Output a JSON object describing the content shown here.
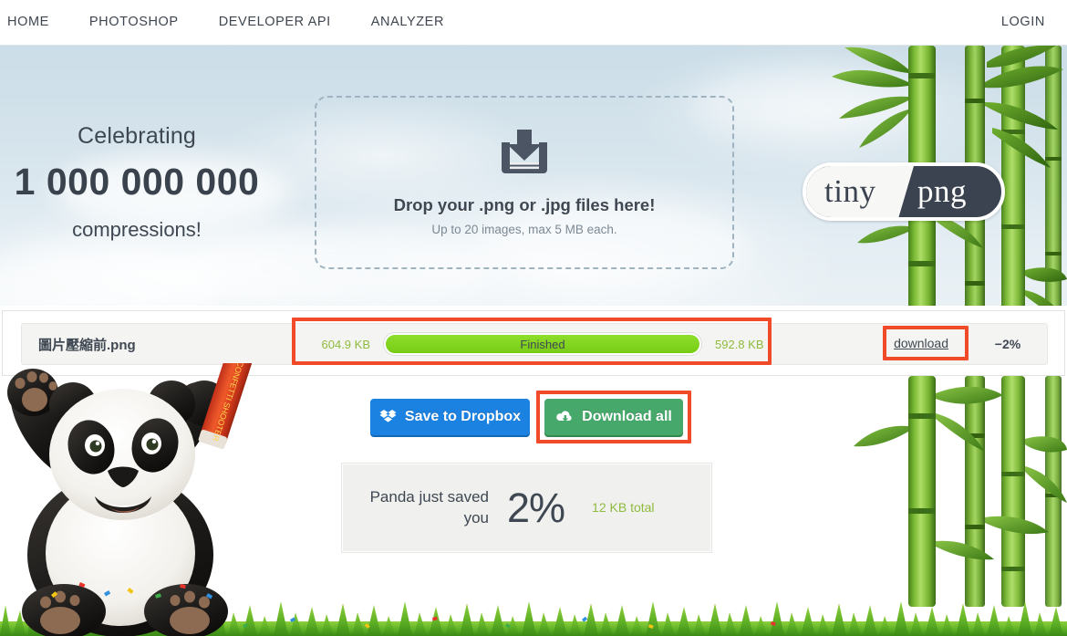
{
  "nav": {
    "left_items": [
      {
        "label": "HOME",
        "name": "nav-item-home"
      },
      {
        "label": "PHOTOSHOP",
        "name": "nav-item-photoshop"
      },
      {
        "label": "DEVELOPER API",
        "name": "nav-item-developer-api"
      },
      {
        "label": "ANALYZER",
        "name": "nav-item-analyzer"
      }
    ],
    "right_items": [
      {
        "label": "LOGIN",
        "name": "nav-item-login"
      }
    ]
  },
  "hero": {
    "celebrate_line1": "Celebrating",
    "celebrate_number": "1 000 000 000",
    "celebrate_line3": "compressions!",
    "logo_tiny": "tiny",
    "logo_png": "png"
  },
  "dropzone": {
    "icon": "download-tray-icon",
    "title": "Drop your .png or .jpg files here!",
    "subtitle": "Up to 20 images, max 5 MB each."
  },
  "results": {
    "rows": [
      {
        "filename": "圖片壓縮前.png",
        "size_before": "604.9 KB",
        "progress_label": "Finished",
        "progress_percent": 100,
        "size_after": "592.8 KB",
        "download_label": "download",
        "saving_percent": "−2%"
      }
    ]
  },
  "actions": {
    "dropbox_label": "Save to Dropbox",
    "dropbox_icon": "dropbox-icon",
    "download_all_label": "Download all",
    "download_all_icon": "cloud-download-icon"
  },
  "savings": {
    "text": "Panda just saved you",
    "percent": "2%",
    "total": "12 KB total"
  },
  "colors": {
    "accent_green": "#7ed321",
    "progress_green": "#82d616",
    "button_green": "#46a86b",
    "dropbox_blue": "#1b82e2",
    "annotation_red": "#f04a28",
    "text_dark": "#3f4852",
    "savings_green": "#8fbb3e"
  }
}
